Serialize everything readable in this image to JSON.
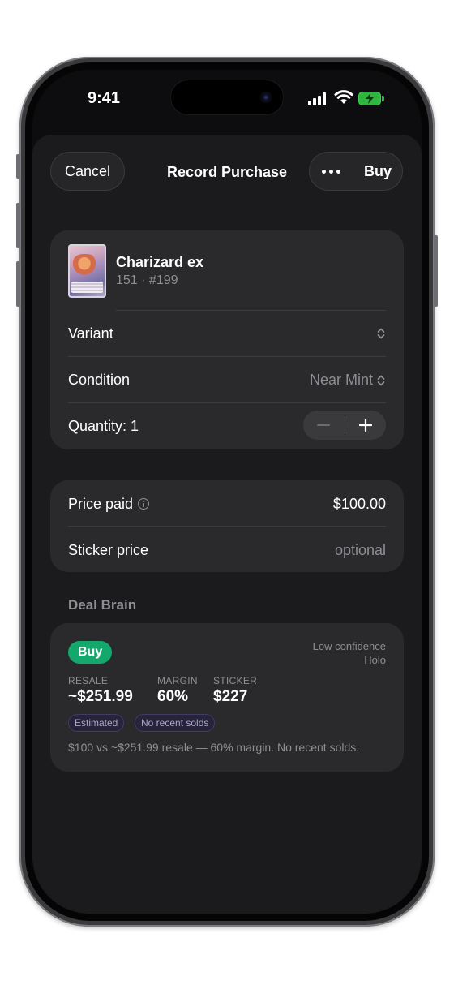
{
  "status_bar": {
    "time": "9:41"
  },
  "nav": {
    "cancel_label": "Cancel",
    "title": "Record Purchase",
    "buy_label": "Buy"
  },
  "card": {
    "name": "Charizard ex",
    "subtitle": "151 · #199"
  },
  "rows": {
    "variant_label": "Variant",
    "condition_label": "Condition",
    "condition_value": "Near Mint",
    "quantity_label": "Quantity: 1"
  },
  "pricing": {
    "price_paid_label": "Price paid",
    "price_paid_value": "$100.00",
    "sticker_label": "Sticker price",
    "sticker_placeholder": "optional"
  },
  "deal_brain": {
    "section_title": "Deal Brain",
    "verdict": "Buy",
    "confidence": "Low confidence",
    "finish": "Holo",
    "stats": [
      {
        "label": "RESALE",
        "value": "~$251.99"
      },
      {
        "label": "MARGIN",
        "value": "60%"
      },
      {
        "label": "STICKER",
        "value": "$227"
      }
    ],
    "tags": [
      "Estimated",
      "No recent solds"
    ],
    "summary": "$100 vs ~$251.99 resale — 60% margin. No recent solds."
  },
  "colors": {
    "verdict_green": "#15a86c",
    "battery_green": "#2fb640",
    "sheet_bg": "#1b1b1d",
    "card_bg": "#2a2a2c"
  }
}
